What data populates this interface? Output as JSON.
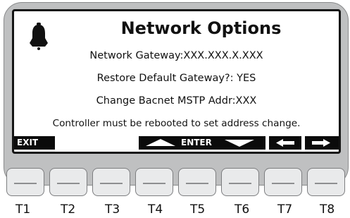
{
  "screen": {
    "title": "Network Options",
    "lines": [
      "Network Gateway:XXX.XXX.X.XXX",
      "Restore Default Gateway?: YES",
      "Change Bacnet MSTP Addr:XXX"
    ],
    "note": "Controller must be rebooted to set address change.",
    "icon": "bell-icon"
  },
  "softkeys": {
    "exit": "EXIT",
    "enter": "ENTER",
    "icons": [
      "up-arrow-icon",
      "down-arrow-icon",
      "left-arrow-icon",
      "right-arrow-icon"
    ]
  },
  "keys": [
    "T1",
    "T2",
    "T3",
    "T4",
    "T5",
    "T6",
    "T7",
    "T8"
  ],
  "colors": {
    "bezel": "#bfc0c1",
    "screen": "#ffffff",
    "softbar": "#0b0b0b"
  }
}
